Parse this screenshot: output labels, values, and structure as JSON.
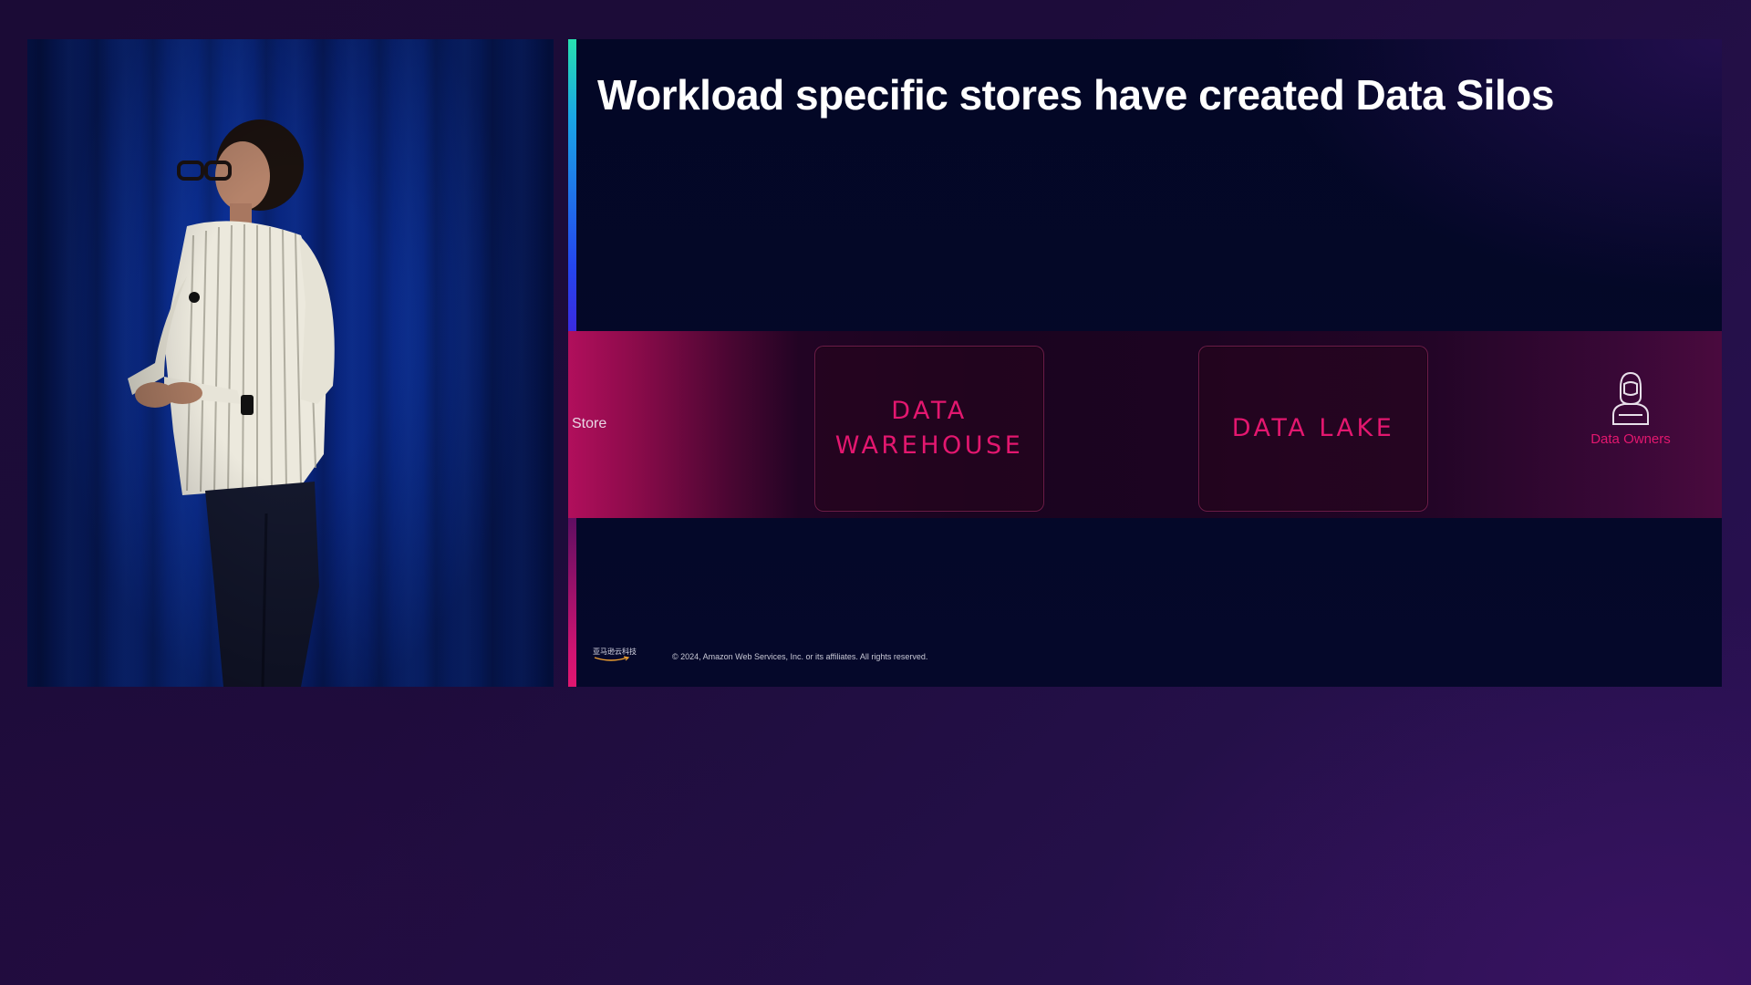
{
  "slide": {
    "title": "Workload specific stores have created Data Silos",
    "band_label": "Store",
    "stores": [
      {
        "label": "DATA WAREHOUSE"
      },
      {
        "label": "DATA LAKE"
      }
    ],
    "owners_label": "Data Owners",
    "logo_text": "亚马逊云科技",
    "copyright": "© 2024, Amazon Web Services, Inc. or its affiliates. All rights reserved."
  },
  "colors": {
    "accent_pink": "#e3176f",
    "title_white": "#ffffff",
    "curtain_blue": "#0b2f95",
    "background_purple": "#1d0c3a"
  },
  "icons": {
    "owners": "astronaut-icon",
    "logo_smile": "amazon-smile-icon"
  }
}
